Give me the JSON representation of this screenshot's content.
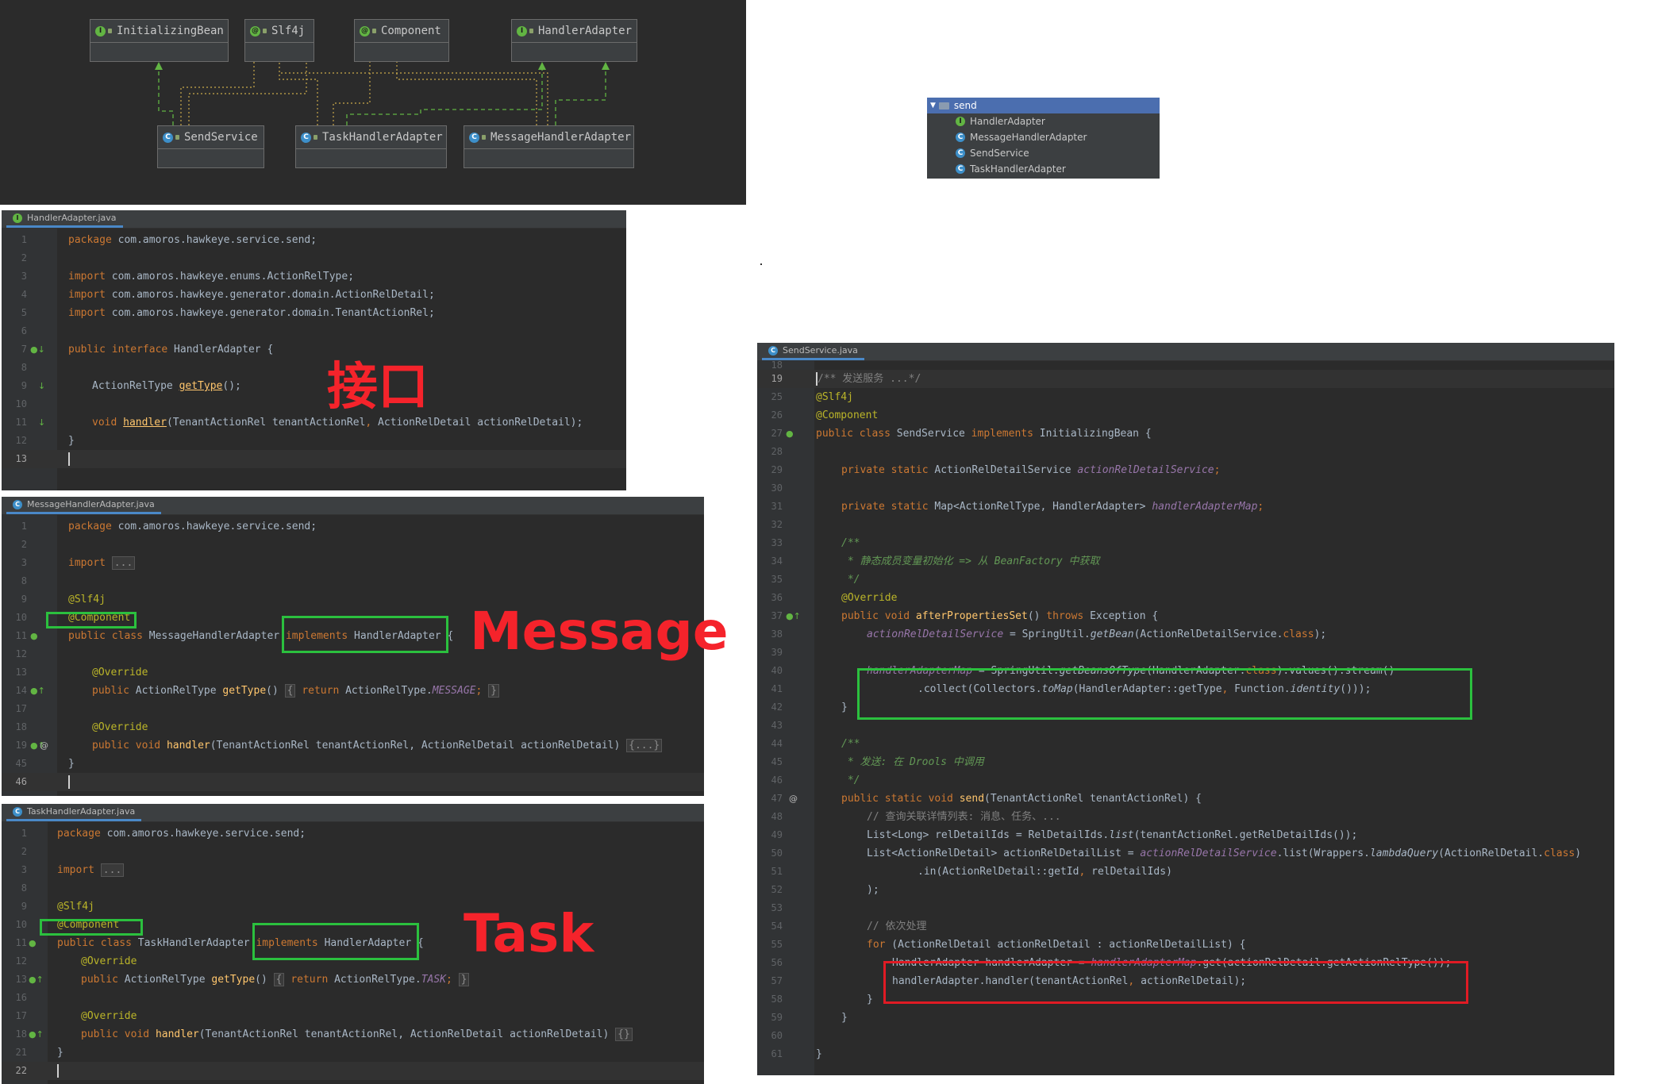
{
  "uml": {
    "interfaces": [
      {
        "name": "InitializingBean",
        "icon": "interface-icon"
      },
      {
        "name": "Slf4j",
        "icon": "annotation-icon"
      },
      {
        "name": "Component",
        "icon": "annotation-icon"
      },
      {
        "name": "HandlerAdapter",
        "icon": "interface-icon"
      }
    ],
    "classes": [
      {
        "name": "SendService",
        "icon": "class-icon"
      },
      {
        "name": "TaskHandlerAdapter",
        "icon": "class-icon"
      },
      {
        "name": "MessageHandlerAdapter",
        "icon": "class-icon"
      }
    ]
  },
  "project_tree": {
    "folder": "send",
    "items": [
      "HandlerAdapter",
      "MessageHandlerAdapter",
      "SendService",
      "TaskHandlerAdapter"
    ]
  },
  "labels": {
    "interface": "接口",
    "message": "Message",
    "task": "Task"
  },
  "editors": {
    "handler_adapter": {
      "tab": "HandlerAdapter.java",
      "line_numbers": [
        "1",
        "2",
        "3",
        "4",
        "5",
        "6",
        "7",
        "8",
        "9",
        "10",
        "11",
        "12",
        "13"
      ],
      "text": {
        "pkg_kw": "package",
        "pkg": " com.amoros.hawkeye.service.send;",
        "import_kw": "import",
        "imp1": " com.amoros.hawkeye.enums.ActionRelType;",
        "imp2": " com.amoros.hawkeye.generator.domain.ActionRelDetail;",
        "imp3": " com.amoros.hawkeye.generator.domain.TenantActionRel;",
        "public_interface": "public interface",
        "decl": " HandlerAdapter {",
        "type": "ActionRelType ",
        "get_type": "getType",
        "get_type_rest": "();",
        "void": "void ",
        "handler": "handler",
        "handler_args_a": "(TenantActionRel tenantActionRel",
        "comma": ",",
        "handler_args_b": " ActionRelDetail actionRelDetail);",
        "close": "}"
      }
    },
    "message_handler": {
      "tab": "MessageHandlerAdapter.java",
      "line_numbers": [
        "1",
        "2",
        "3",
        "8",
        "9",
        "10",
        "11",
        "12",
        "13",
        "14",
        "17",
        "18",
        "19",
        "45",
        "46"
      ],
      "text": {
        "pkg_kw": "package",
        "pkg": " com.amoros.hawkeye.service.send;",
        "import_kw": "import",
        "ellipsis": "...",
        "slf4j": "@Slf4j",
        "component": "@Component",
        "public_class": "public class",
        "cls": " MessageHandlerAdapter ",
        "implements": "implements",
        "iface": " HandlerAdapter",
        "brace": " {",
        "override": "@Override",
        "public": "public ",
        "type": "ActionRelType ",
        "get_type": "getType",
        "parens": "()",
        "return": "return",
        "ret_val": " ActionRelType.",
        "enum": "MESSAGE",
        "semi": ";",
        "void": "void ",
        "handler": "handler",
        "handler_args": "(TenantActionRel tenantActionRel, ActionRelDetail actionRelDetail) ",
        "body": "{...}",
        "close": "}"
      }
    },
    "task_handler": {
      "tab": "TaskHandlerAdapter.java",
      "line_numbers": [
        "1",
        "2",
        "3",
        "8",
        "9",
        "10",
        "11",
        "12",
        "13",
        "16",
        "17",
        "18",
        "21",
        "22"
      ],
      "text": {
        "pkg_kw": "package",
        "pkg": " com.amoros.hawkeye.service.send;",
        "import_kw": "import",
        "ellipsis": "...",
        "slf4j": "@Slf4j",
        "component": "@Component",
        "public_class": "public class",
        "cls": " TaskHandlerAdapter ",
        "implements": "implements",
        "iface": " HandlerAdapter",
        "brace": " {",
        "override": "@Override",
        "public": "public ",
        "type": "ActionRelType ",
        "get_type": "getType",
        "parens": "()",
        "return": "return",
        "ret_val": " ActionRelType.",
        "enum": "TASK",
        "semi": ";",
        "void": "void ",
        "handler": "handler",
        "handler_args": "(TenantActionRel tenantActionRel, ActionRelDetail actionRelDetail) ",
        "body": "{}",
        "close": "}"
      }
    },
    "send_service": {
      "tab": "SendService.java",
      "line_numbers": [
        "18",
        "19",
        "25",
        "26",
        "27",
        "28",
        "29",
        "30",
        "31",
        "32",
        "33",
        "34",
        "35",
        "36",
        "37",
        "38",
        "39",
        "40",
        "41",
        "42",
        "43",
        "44",
        "45",
        "46",
        "47",
        "48",
        "49",
        "50",
        "51",
        "52",
        "53",
        "54",
        "55",
        "56",
        "57",
        "58",
        "59",
        "60",
        "61"
      ],
      "text": {
        "doc_fold": "/** 发送服务 ...*/",
        "slf4j": "@Slf4j",
        "component": "@Component",
        "public_class": "public class",
        "cls": " SendService ",
        "implements": "implements",
        "iface": " InitializingBean {",
        "private_static": "private static",
        "svc_type": " ActionRelDetailService ",
        "svc_field": "actionRelDetailService",
        "semi": ";",
        "map_type": " Map<ActionRelType, HandlerAdapter> ",
        "map_field": "handlerAdapterMap",
        "doc_open": "/**",
        "doc_init": " * 静态成员变量初始化 => 从 BeanFactory 中获取",
        "doc_close": " */",
        "override": "@Override",
        "public_void": "public void ",
        "after": "afterPropertiesSet",
        "after_rest": "() ",
        "throws": "throws",
        "exception": " Exception {",
        "assign1_rest": " = SpringUtil.",
        "get_bean": "getBean",
        "get_bean_args": "(ActionRelDetailService.",
        "class_kw": "class",
        "close_paren_semi": ");",
        "assign2_rest": " = SpringUtil.",
        "get_beans": "getBeansOfType",
        "get_beans_args": "(HandlerAdapter.",
        "values_stream": ").values().stream()",
        "collect": ".collect(Collectors.",
        "to_map": "toMap",
        "to_map_args": "(HandlerAdapter::getType",
        "comma": ",",
        "func": " Function.",
        "identity": "identity",
        "collect_end": "()));",
        "close_brace": "}",
        "doc_send": " * 发送: 在 Drools 中调用",
        "public_static_void": "public static void ",
        "send": "send",
        "send_args": "(TenantActionRel tenantActionRel) {",
        "comment_query": "// 查询关联详情列表: 消息、任务、...",
        "list_long": "List<Long> relDetailIds = RelDetailIds.",
        "list_m": "list",
        "list_args": "(tenantActionRel.getRelDetailIds());",
        "list_detail": "List<ActionRelDetail> actionRelDetailList = ",
        "list2": ".list(Wrappers.",
        "lambda_query": "lambdaQuery",
        "lq_args": "(ActionRelDetail.",
        "in_call": ".in(ActionRelDetail::getId",
        "in_args": " relDetailIds)",
        "close_paren": ");",
        "comment_loop": "// 依次处理",
        "for_kw": "for",
        "for_args": " (ActionRelDetail actionRelDetail : actionRelDetailList) {",
        "ha_decl": "HandlerAdapter handlerAdapter = ",
        "get_call": ".get(actionRelDetail.getActionRelType());",
        "ha_call_a": "handlerAdapter.handler(tenantActionRel",
        "ha_call_b": " actionRelDetail);"
      }
    }
  },
  "colors": {
    "editor_bg": "#2b2b2b",
    "keyword": "#cc7832",
    "annotation": "#bbb529",
    "field": "#9876aa",
    "method": "#ffc66d",
    "doc_comment": "#629755",
    "highlight_green": "#2bc03e",
    "highlight_red": "#e01b24",
    "tree_selected": "#4b6eaf"
  }
}
